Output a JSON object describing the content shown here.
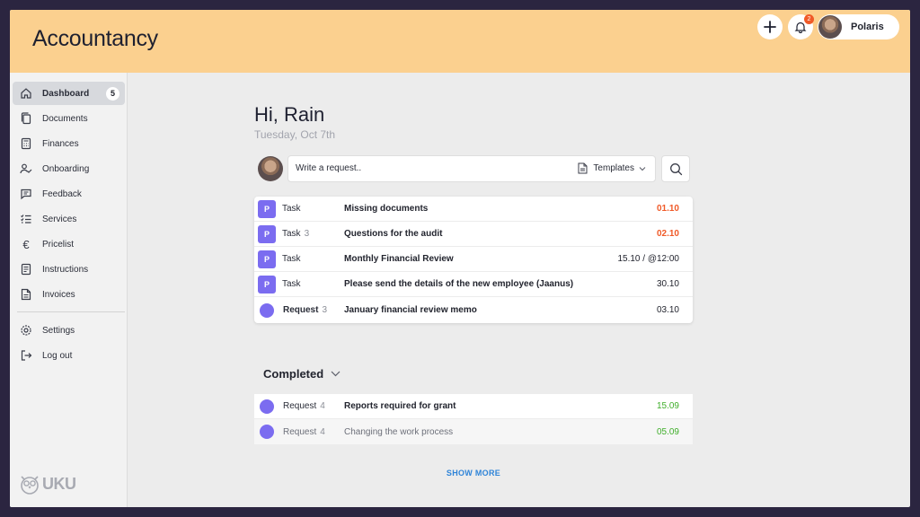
{
  "header": {
    "title": "Accountancy",
    "notification_count": "2",
    "user_name": "Polaris"
  },
  "sidebar": {
    "items": [
      {
        "label": "Dashboard",
        "icon": "home-icon",
        "badge": "5",
        "active": true
      },
      {
        "label": "Documents",
        "icon": "documents-icon"
      },
      {
        "label": "Finances",
        "icon": "calculator-icon"
      },
      {
        "label": "Onboarding",
        "icon": "user-check-icon"
      },
      {
        "label": "Feedback",
        "icon": "chat-icon"
      },
      {
        "label": "Services",
        "icon": "list-icon"
      },
      {
        "label": "Pricelist",
        "icon": "euro-icon"
      },
      {
        "label": "Instructions",
        "icon": "instructions-icon"
      },
      {
        "label": "Invoices",
        "icon": "invoice-icon"
      }
    ],
    "bottom_items": [
      {
        "label": "Settings",
        "icon": "gear-icon"
      },
      {
        "label": "Log out",
        "icon": "logout-icon"
      }
    ],
    "logo_text": "UKU"
  },
  "main": {
    "greeting": "Hi, Rain",
    "date": "Tuesday, Oct 7th",
    "request_placeholder": "Write a request..",
    "templates_label": "Templates",
    "tasks": [
      {
        "icon_letter": "P",
        "type": "Task",
        "count": "",
        "title": "Missing documents",
        "date": "01.10",
        "date_color": "#f05a28"
      },
      {
        "icon_letter": "P",
        "type": "Task",
        "count": "3",
        "title": "Questions for the audit",
        "date": "02.10",
        "date_color": "#f05a28"
      },
      {
        "icon_letter": "P",
        "type": "Task",
        "count": "",
        "title": "Monthly Financial Review",
        "date": "15.10 / @12:00",
        "date_color": "#2a2d38"
      },
      {
        "icon_letter": "P",
        "type": "Task",
        "count": "",
        "title": "Please send the details of the new employee (Jaanus)",
        "date": "30.10",
        "date_color": "#2a2d38"
      },
      {
        "icon_letter": "",
        "type": "Request",
        "count": "3",
        "title": "January financial review memo",
        "date": "03.10",
        "date_color": "#2a2d38"
      }
    ],
    "completed_label": "Completed",
    "completed": [
      {
        "type": "Request",
        "count": "4",
        "title": "Reports required for grant",
        "date": "15.09",
        "date_color": "#3fae2a"
      },
      {
        "type": "Request",
        "count": "4",
        "title": "Changing the work process",
        "date": "05.09",
        "date_color": "#3fae2a"
      }
    ],
    "show_more": "SHOW MORE"
  },
  "colors": {
    "header_bg": "#fbd08f",
    "accent_purple": "#7b6cf0",
    "overdue": "#f05a28",
    "done": "#3fae2a",
    "link": "#2f84d8"
  }
}
